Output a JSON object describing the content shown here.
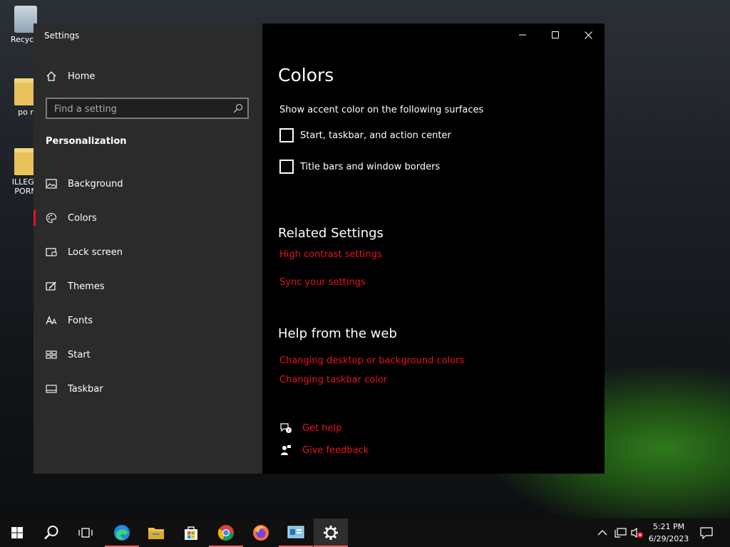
{
  "desktop": {
    "icons": [
      {
        "label": "Recycle"
      },
      {
        "label": "po r"
      },
      {
        "label": "ILLEGA PORN"
      }
    ]
  },
  "window": {
    "title": "Settings",
    "home_label": "Home",
    "search_placeholder": "Find a setting",
    "section": "Personalization",
    "nav": [
      {
        "label": "Background",
        "icon": "picture-icon"
      },
      {
        "label": "Colors",
        "icon": "palette-icon",
        "active": true
      },
      {
        "label": "Lock screen",
        "icon": "lock-screen-icon"
      },
      {
        "label": "Themes",
        "icon": "brush-icon"
      },
      {
        "label": "Fonts",
        "icon": "font-icon"
      },
      {
        "label": "Start",
        "icon": "start-icon"
      },
      {
        "label": "Taskbar",
        "icon": "taskbar-icon"
      }
    ]
  },
  "content": {
    "title": "Colors",
    "accent_heading": "Show accent color on the following surfaces",
    "checkboxes": [
      {
        "label": "Start, taskbar, and action center",
        "checked": false
      },
      {
        "label": "Title bars and window borders",
        "checked": false
      }
    ],
    "related_heading": "Related Settings",
    "related_links": [
      "High contrast settings",
      "Sync your settings"
    ],
    "help_heading": "Help from the web",
    "help_links": [
      "Changing desktop or background colors",
      "Changing taskbar color"
    ],
    "get_help": "Get help",
    "give_feedback": "Give feedback"
  },
  "taskbar": {
    "time": "5:21 PM",
    "date": "6/29/2023"
  },
  "colors": {
    "accent": "#e81123",
    "sidebar_bg": "#2b2b2b",
    "content_bg": "#000000"
  }
}
